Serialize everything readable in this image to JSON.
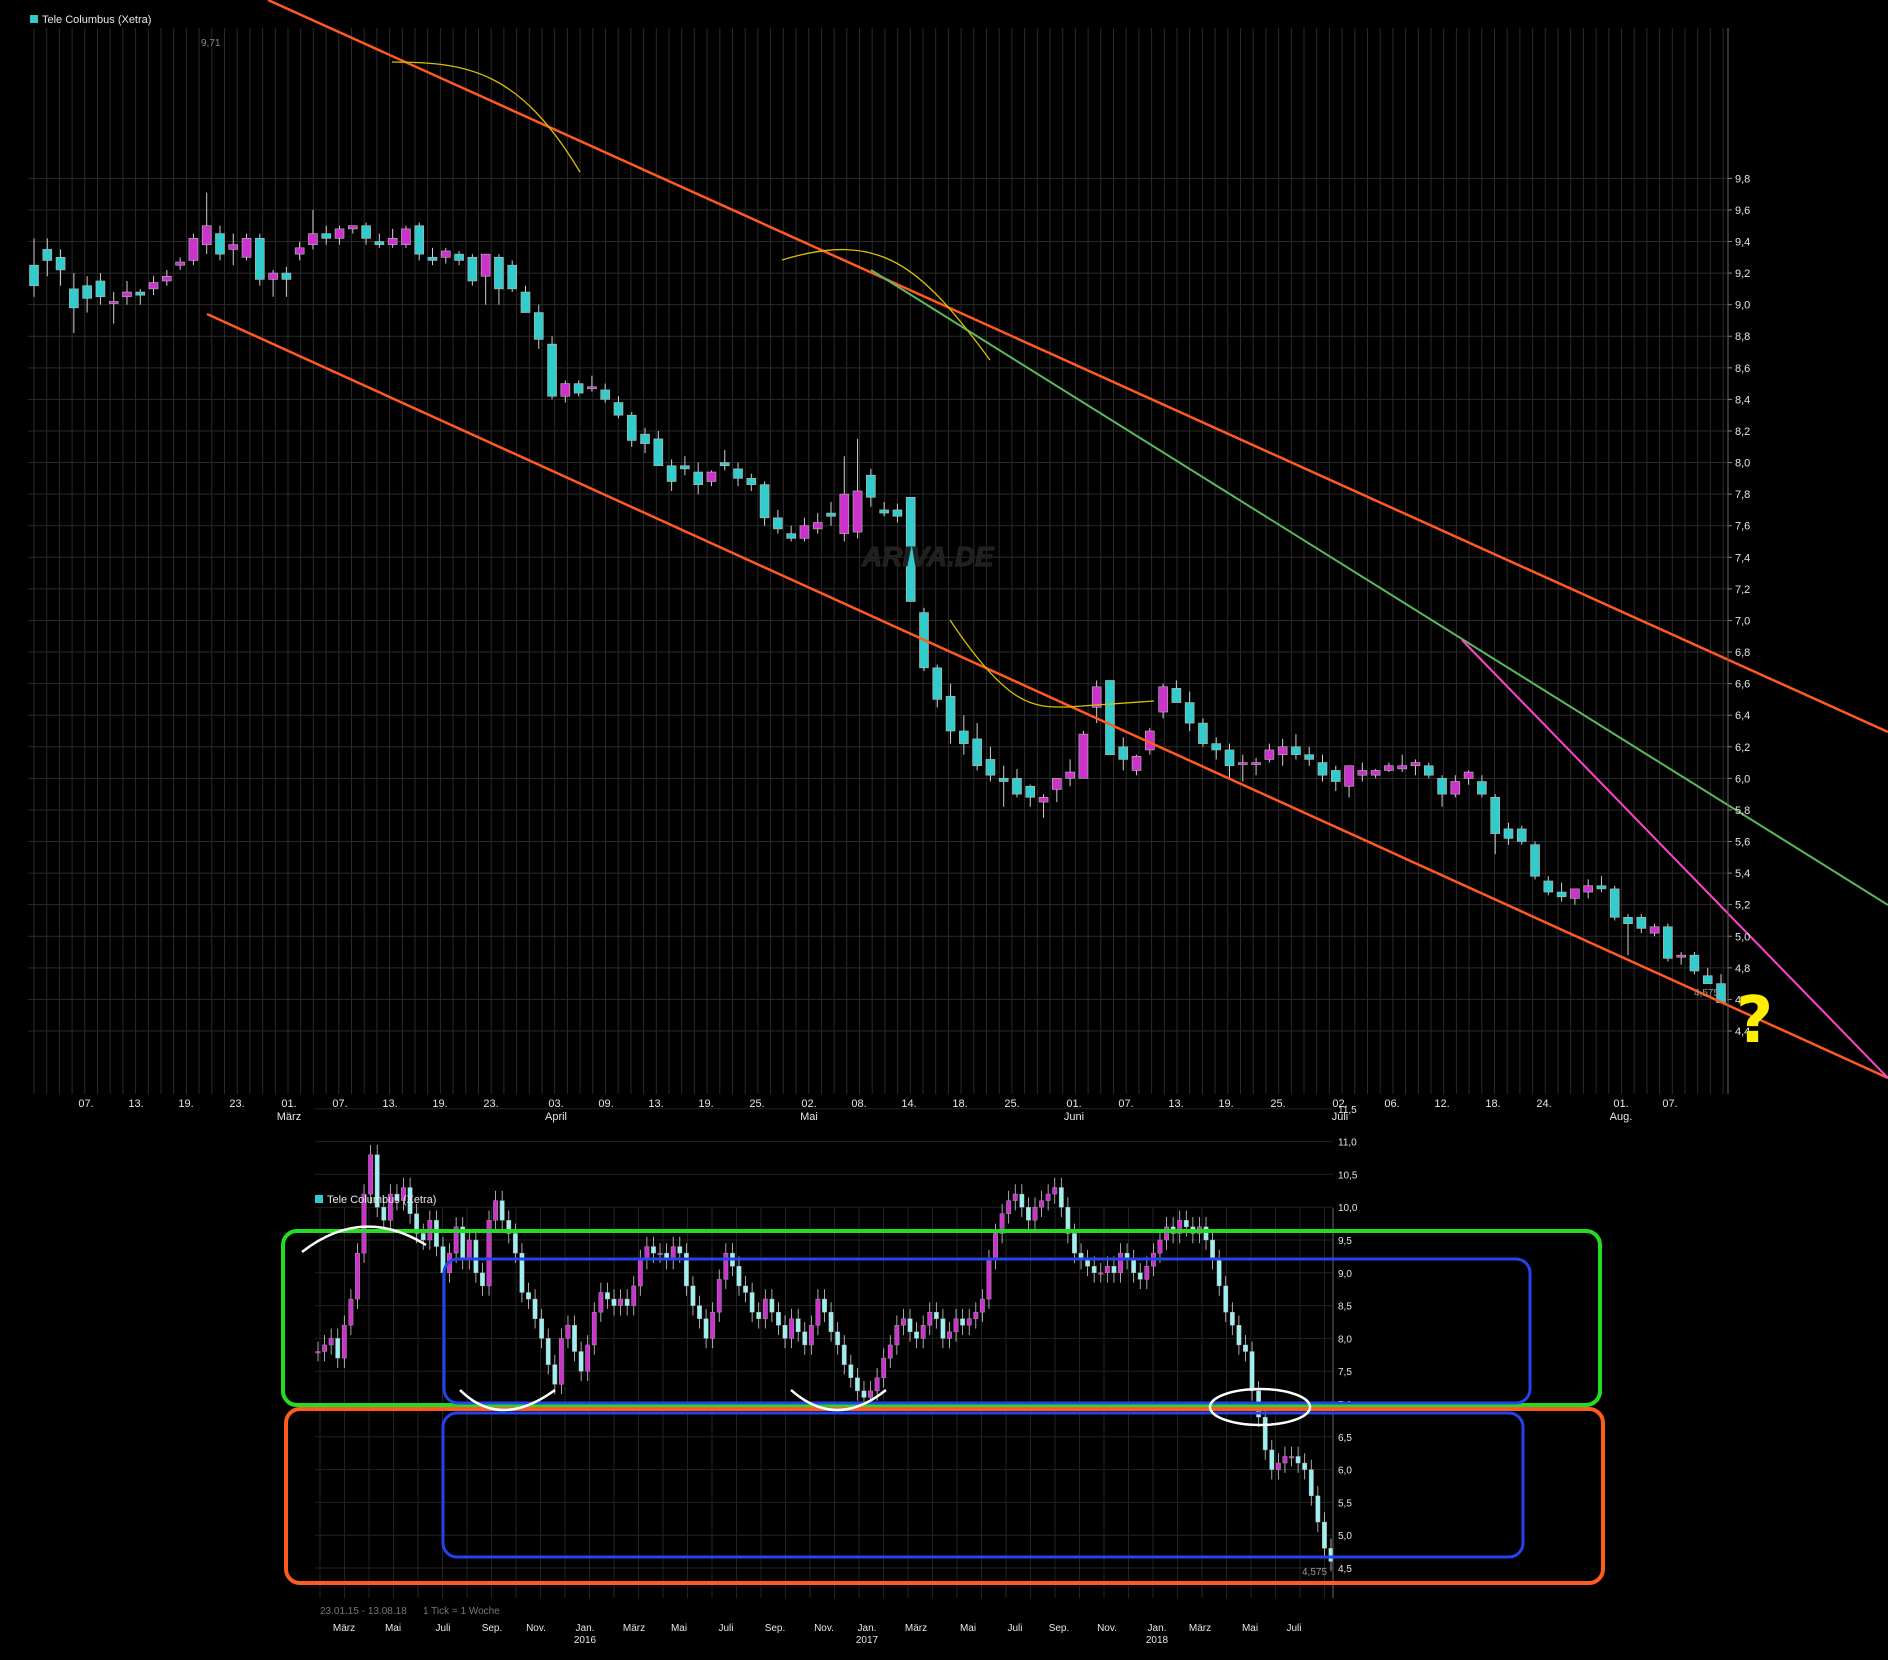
{
  "colors": {
    "background": "#000000",
    "grid": "#2a2a2a",
    "candle_up": "#cc33cc",
    "candle_down": "#33cccc",
    "channel": "#ff5a1f",
    "trend_green": "#5cb85c",
    "trend_pink": "#ff44cc",
    "curve_yellow": "#d8c000",
    "question": "#ffee00",
    "box_green": "#22dd22",
    "box_orange": "#ff5a1f",
    "box_blue": "#2244ee",
    "marker_white": "#ffffff"
  },
  "main_chart": {
    "legend": "Tele Columbus (Xetra)",
    "watermark": "ARIVA.DE",
    "peak_label": "9,71",
    "last_label": "4,575",
    "question_mark": "?",
    "y_ticks": [
      "9,8",
      "9,6",
      "9,4",
      "9,2",
      "9,0",
      "8,8",
      "8,6",
      "8,4",
      "8,2",
      "8,0",
      "7,8",
      "7,6",
      "7,4",
      "7,2",
      "7,0",
      "6,8",
      "6,6",
      "6,4",
      "6,2",
      "6,0",
      "5,8",
      "5,6",
      "5,4",
      "5,2",
      "5,0",
      "4,8",
      "4,6",
      "4,4"
    ],
    "x_ticks": [
      "07.",
      "13.",
      "19.",
      "23.",
      "01.",
      "07.",
      "13.",
      "19.",
      "23.",
      "03.",
      "09.",
      "13.",
      "19.",
      "25.",
      "02.",
      "08.",
      "14.",
      "18.",
      "25.",
      "01.",
      "07.",
      "13.",
      "19.",
      "25.",
      "02.",
      "06.",
      "12.",
      "18.",
      "24.",
      "01.",
      "07."
    ],
    "month_labels": [
      "März",
      "April",
      "Mai",
      "Juni",
      "Juli",
      "Aug."
    ]
  },
  "bottom_chart": {
    "legend": "Tele Columbus (Xetra)",
    "last_label": "4,575",
    "range_label": "23.01.15 - 13.08.18",
    "tick_label": "1 Tick = 1 Woche",
    "y_ticks": [
      "11,5",
      "11,0",
      "10,5",
      "10,0",
      "9,5",
      "9,0",
      "8,5",
      "8,0",
      "7,5",
      "7,0",
      "6,5",
      "6,0",
      "5,5",
      "5,0",
      "4,5"
    ],
    "x_ticks": [
      "März",
      "Mai",
      "Juli",
      "Sep.",
      "Nov.",
      "Jan.",
      "März",
      "Mai",
      "Juli",
      "Sep.",
      "Nov.",
      "Jan.",
      "März",
      "Mai",
      "Juli",
      "Sep.",
      "Nov.",
      "Jan.",
      "März",
      "Mai",
      "Juli"
    ],
    "year_labels": [
      "2016",
      "2017",
      "2018"
    ]
  },
  "chart_data": [
    {
      "type": "candlestick",
      "title": "Tele Columbus (Xetra)",
      "period": "daily, Feb – Aug 2018",
      "ylim": [
        4.2,
        9.9
      ],
      "ohlc": [
        [
          9.25,
          9.42,
          9.05,
          9.12
        ],
        [
          9.35,
          9.42,
          9.18,
          9.28
        ],
        [
          9.3,
          9.35,
          9.12,
          9.22
        ],
        [
          9.1,
          9.2,
          8.82,
          8.98
        ],
        [
          9.12,
          9.18,
          8.95,
          9.04
        ],
        [
          9.15,
          9.2,
          9.0,
          9.05
        ],
        [
          9.02,
          9.08,
          8.88,
          9.02
        ],
        [
          9.05,
          9.15,
          9.0,
          9.08
        ],
        [
          9.08,
          9.1,
          9.0,
          9.06
        ],
        [
          9.1,
          9.18,
          9.06,
          9.14
        ],
        [
          9.15,
          9.22,
          9.12,
          9.18
        ],
        [
          9.25,
          9.3,
          9.22,
          9.27
        ],
        [
          9.28,
          9.45,
          9.25,
          9.42
        ],
        [
          9.38,
          9.71,
          9.32,
          9.5
        ],
        [
          9.45,
          9.5,
          9.28,
          9.32
        ],
        [
          9.35,
          9.45,
          9.25,
          9.38
        ],
        [
          9.3,
          9.45,
          9.28,
          9.42
        ],
        [
          9.42,
          9.45,
          9.12,
          9.16
        ],
        [
          9.16,
          9.22,
          9.05,
          9.2
        ],
        [
          9.2,
          9.24,
          9.05,
          9.16
        ],
        [
          9.32,
          9.4,
          9.28,
          9.36
        ],
        [
          9.38,
          9.6,
          9.35,
          9.45
        ],
        [
          9.45,
          9.5,
          9.38,
          9.42
        ],
        [
          9.42,
          9.5,
          9.38,
          9.48
        ],
        [
          9.48,
          9.5,
          9.45,
          9.5
        ],
        [
          9.5,
          9.52,
          9.38,
          9.42
        ],
        [
          9.4,
          9.45,
          9.36,
          9.38
        ],
        [
          9.38,
          9.48,
          9.36,
          9.42
        ],
        [
          9.38,
          9.5,
          9.36,
          9.48
        ],
        [
          9.5,
          9.52,
          9.28,
          9.32
        ],
        [
          9.3,
          9.36,
          9.25,
          9.28
        ],
        [
          9.3,
          9.36,
          9.26,
          9.34
        ],
        [
          9.32,
          9.34,
          9.25,
          9.28
        ],
        [
          9.3,
          9.32,
          9.12,
          9.15
        ],
        [
          9.18,
          9.22,
          9.0,
          9.32
        ],
        [
          9.3,
          9.32,
          9.0,
          9.1
        ],
        [
          9.25,
          9.28,
          9.08,
          9.1
        ],
        [
          9.08,
          9.12,
          8.95,
          8.95
        ],
        [
          8.95,
          9.0,
          8.72,
          8.78
        ],
        [
          8.75,
          8.8,
          8.4,
          8.42
        ],
        [
          8.42,
          8.52,
          8.38,
          8.5
        ],
        [
          8.5,
          8.52,
          8.42,
          8.44
        ],
        [
          8.48,
          8.55,
          8.45,
          8.48
        ],
        [
          8.46,
          8.5,
          8.38,
          8.4
        ],
        [
          8.38,
          8.42,
          8.28,
          8.3
        ],
        [
          8.3,
          8.32,
          8.1,
          8.14
        ],
        [
          8.18,
          8.22,
          8.06,
          8.12
        ],
        [
          8.15,
          8.2,
          7.98,
          7.98
        ],
        [
          7.98,
          8.02,
          7.82,
          7.88
        ],
        [
          7.98,
          8.04,
          7.92,
          7.96
        ],
        [
          7.94,
          8.0,
          7.8,
          7.86
        ],
        [
          7.88,
          7.95,
          7.85,
          7.94
        ],
        [
          8.0,
          8.08,
          7.95,
          7.98
        ],
        [
          7.96,
          8.0,
          7.85,
          7.9
        ],
        [
          7.9,
          7.93,
          7.82,
          7.86
        ],
        [
          7.86,
          7.88,
          7.6,
          7.65
        ],
        [
          7.65,
          7.7,
          7.55,
          7.58
        ],
        [
          7.55,
          7.6,
          7.5,
          7.52
        ],
        [
          7.52,
          7.65,
          7.5,
          7.6
        ],
        [
          7.58,
          7.68,
          7.55,
          7.62
        ],
        [
          7.68,
          7.75,
          7.6,
          7.66
        ],
        [
          7.55,
          8.04,
          7.5,
          7.8
        ],
        [
          7.56,
          8.15,
          7.52,
          7.82
        ],
        [
          7.92,
          7.96,
          7.72,
          7.78
        ],
        [
          7.7,
          7.75,
          7.66,
          7.68
        ],
        [
          7.7,
          7.74,
          7.62,
          7.66
        ],
        [
          7.78,
          7.78,
          7.12,
          7.12
        ],
        [
          7.05,
          7.08,
          6.68,
          6.7
        ],
        [
          6.7,
          6.72,
          6.45,
          6.5
        ],
        [
          6.52,
          6.6,
          6.22,
          6.3
        ],
        [
          6.3,
          6.4,
          6.15,
          6.22
        ],
        [
          6.25,
          6.35,
          6.05,
          6.08
        ],
        [
          6.12,
          6.2,
          5.98,
          6.02
        ],
        [
          6.0,
          6.08,
          5.82,
          5.98
        ],
        [
          6.0,
          6.06,
          5.88,
          5.9
        ],
        [
          5.95,
          5.96,
          5.82,
          5.88
        ],
        [
          5.85,
          5.9,
          5.75,
          5.88
        ],
        [
          5.93,
          6.0,
          5.85,
          6.0
        ],
        [
          6.0,
          6.12,
          5.95,
          6.04
        ],
        [
          6.0,
          6.3,
          6.0,
          6.28
        ],
        [
          6.45,
          6.62,
          6.35,
          6.58
        ],
        [
          6.62,
          6.62,
          6.15,
          6.15
        ],
        [
          6.2,
          6.26,
          6.05,
          6.12
        ],
        [
          6.05,
          6.15,
          6.02,
          6.14
        ],
        [
          6.18,
          6.32,
          6.15,
          6.3
        ],
        [
          6.42,
          6.6,
          6.38,
          6.58
        ],
        [
          6.57,
          6.62,
          6.5,
          6.48
        ],
        [
          6.48,
          6.55,
          6.3,
          6.35
        ],
        [
          6.35,
          6.38,
          6.2,
          6.22
        ],
        [
          6.22,
          6.26,
          6.12,
          6.18
        ],
        [
          6.18,
          6.22,
          6.0,
          6.08
        ],
        [
          6.1,
          6.15,
          5.98,
          6.1
        ],
        [
          6.1,
          6.13,
          6.02,
          6.1
        ],
        [
          6.12,
          6.22,
          6.1,
          6.18
        ],
        [
          6.15,
          6.25,
          6.08,
          6.2
        ],
        [
          6.2,
          6.28,
          6.12,
          6.15
        ],
        [
          6.15,
          6.2,
          6.08,
          6.12
        ],
        [
          6.1,
          6.15,
          5.98,
          6.02
        ],
        [
          6.05,
          6.08,
          5.92,
          5.98
        ],
        [
          5.95,
          6.08,
          5.88,
          6.08
        ],
        [
          6.02,
          6.1,
          5.98,
          6.05
        ],
        [
          6.02,
          6.06,
          6.0,
          6.05
        ],
        [
          6.05,
          6.1,
          6.04,
          6.08
        ],
        [
          6.06,
          6.15,
          6.04,
          6.08
        ],
        [
          6.08,
          6.12,
          6.02,
          6.1
        ],
        [
          6.08,
          6.1,
          6.0,
          6.02
        ],
        [
          6.0,
          6.02,
          5.82,
          5.9
        ],
        [
          5.9,
          6.02,
          5.88,
          5.98
        ],
        [
          6.0,
          6.05,
          5.96,
          6.04
        ],
        [
          5.98,
          6.02,
          5.88,
          5.9
        ],
        [
          5.88,
          5.9,
          5.52,
          5.65
        ],
        [
          5.68,
          5.72,
          5.58,
          5.62
        ],
        [
          5.68,
          5.7,
          5.58,
          5.6
        ],
        [
          5.58,
          5.6,
          5.36,
          5.38
        ],
        [
          5.35,
          5.38,
          5.26,
          5.28
        ],
        [
          5.28,
          5.34,
          5.22,
          5.25
        ],
        [
          5.24,
          5.3,
          5.2,
          5.3
        ],
        [
          5.28,
          5.36,
          5.24,
          5.32
        ],
        [
          5.32,
          5.38,
          5.28,
          5.3
        ],
        [
          5.3,
          5.32,
          5.1,
          5.12
        ],
        [
          5.12,
          5.14,
          4.88,
          5.08
        ],
        [
          5.12,
          5.14,
          5.02,
          5.05
        ],
        [
          5.02,
          5.08,
          5.0,
          5.06
        ],
        [
          5.06,
          5.08,
          4.84,
          4.86
        ],
        [
          4.88,
          4.9,
          4.82,
          4.88
        ],
        [
          4.88,
          4.9,
          4.76,
          4.78
        ],
        [
          4.75,
          4.8,
          4.7,
          4.7
        ],
        [
          4.7,
          4.76,
          4.58,
          4.58
        ]
      ]
    },
    {
      "type": "candlestick",
      "title": "Tele Columbus (Xetra)",
      "period": "23.01.15 - 13.08.18, 1 Tick = 1 Woche",
      "ylim": [
        4.4,
        11.6
      ],
      "values": [
        7.8,
        7.9,
        8.0,
        7.7,
        8.2,
        8.6,
        9.3,
        10.2,
        10.8,
        10.0,
        9.8,
        10.2,
        10.1,
        10.3,
        9.9,
        9.6,
        9.5,
        9.8,
        9.4,
        9.0,
        9.3,
        9.7,
        9.2,
        9.5,
        9.0,
        8.8,
        9.8,
        10.1,
        9.8,
        9.6,
        9.3,
        8.7,
        8.6,
        8.3,
        8.0,
        7.6,
        7.3,
        8.0,
        8.2,
        7.8,
        7.5,
        7.9,
        8.4,
        8.7,
        8.6,
        8.5,
        8.6,
        8.5,
        8.8,
        9.2,
        9.4,
        9.3,
        9.3,
        9.2,
        9.4,
        9.3,
        8.8,
        8.5,
        8.3,
        8.0,
        8.4,
        8.9,
        9.3,
        9.1,
        8.8,
        8.7,
        8.4,
        8.3,
        8.6,
        8.4,
        8.2,
        8.0,
        8.3,
        8.1,
        7.9,
        8.2,
        8.6,
        8.4,
        8.1,
        7.9,
        7.6,
        7.4,
        7.2,
        7.1,
        7.2,
        7.4,
        7.7,
        7.9,
        8.2,
        8.3,
        8.1,
        8.0,
        8.2,
        8.4,
        8.3,
        8.0,
        8.1,
        8.3,
        8.2,
        8.3,
        8.4,
        8.6,
        9.2,
        9.6,
        9.9,
        10.1,
        10.2,
        10.0,
        9.8,
        10.0,
        10.1,
        10.2,
        10.3,
        10.0,
        9.6,
        9.3,
        9.2,
        9.1,
        9.0,
        9.0,
        9.1,
        9.0,
        9.3,
        9.2,
        9.0,
        8.9,
        9.1,
        9.3,
        9.5,
        9.7,
        9.6,
        9.8,
        9.7,
        9.6,
        9.7,
        9.5,
        9.2,
        8.8,
        8.4,
        8.2,
        7.9,
        7.8,
        7.2,
        6.8,
        6.3,
        6.0,
        6.1,
        6.2,
        6.2,
        6.1,
        6.0,
        5.6,
        5.2,
        4.8,
        4.6
      ]
    }
  ]
}
